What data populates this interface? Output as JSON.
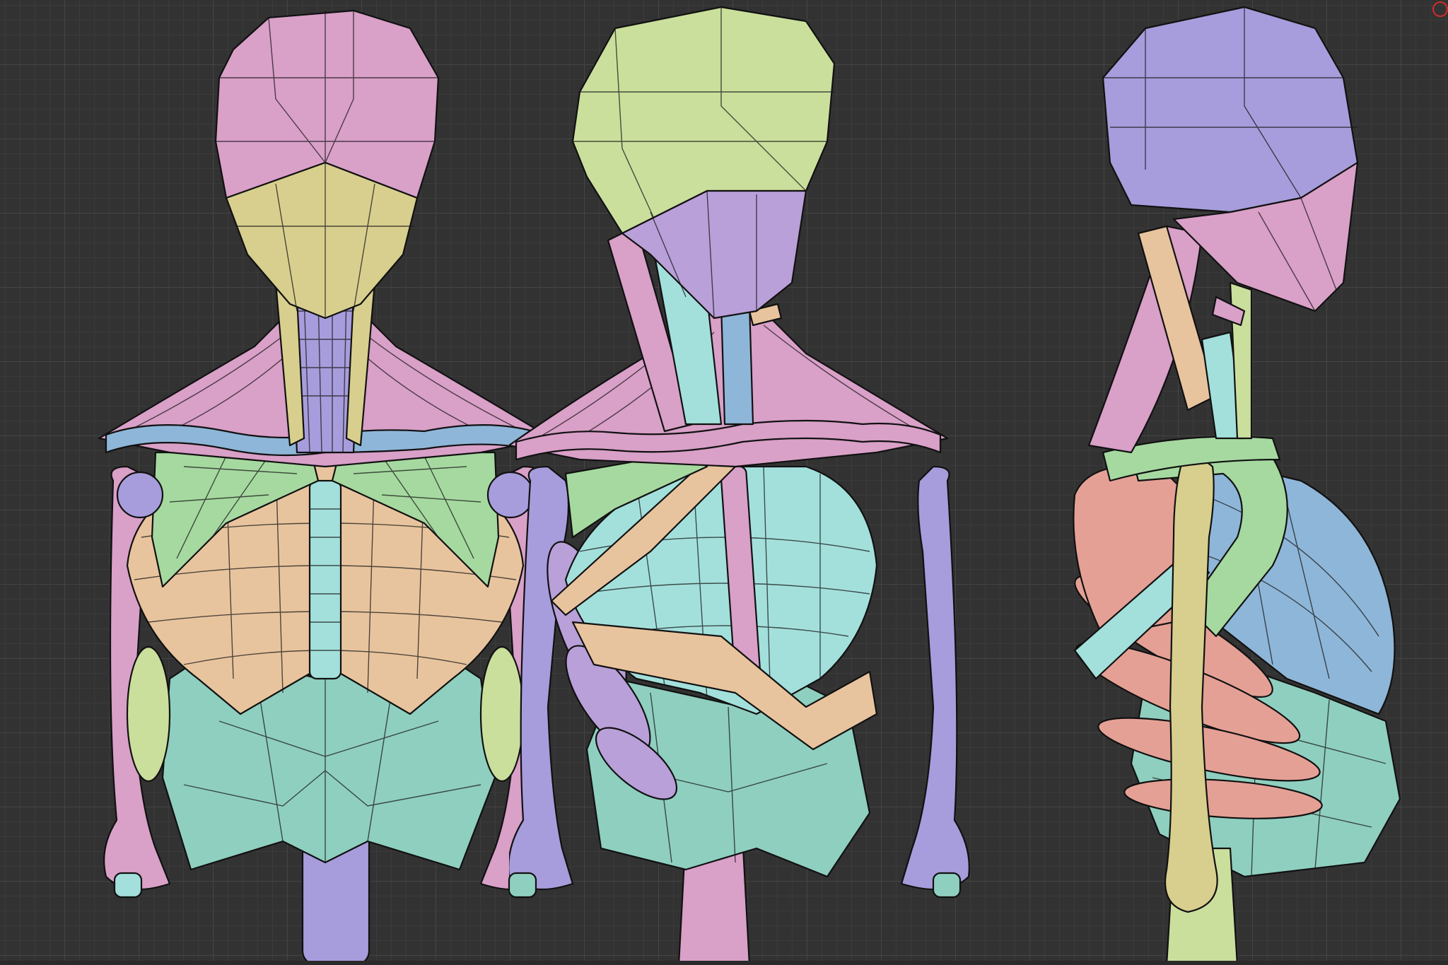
{
  "viewport": {
    "background": "#323232",
    "grid_major": "#454545",
    "grid_minor": "#3b3b3b"
  },
  "views": [
    {
      "id": "front",
      "label": ""
    },
    {
      "id": "three-quarter",
      "label": ""
    },
    {
      "id": "side",
      "label": ""
    }
  ],
  "palette": {
    "pink": "#d9a0c8",
    "yellow": "#d8cf8e",
    "green": "#a6d9a0",
    "peach": "#e8c49e",
    "teal": "#8fcfbf",
    "cyan": "#a3e0dc",
    "blue": "#8eb6d8",
    "purple": "#b9a0d9",
    "violet": "#a79ddc",
    "lime": "#cbdf9d",
    "salmon": "#e5a095"
  },
  "indicator": {
    "icon": "record-indicator-icon",
    "color": "#d92a2a"
  }
}
